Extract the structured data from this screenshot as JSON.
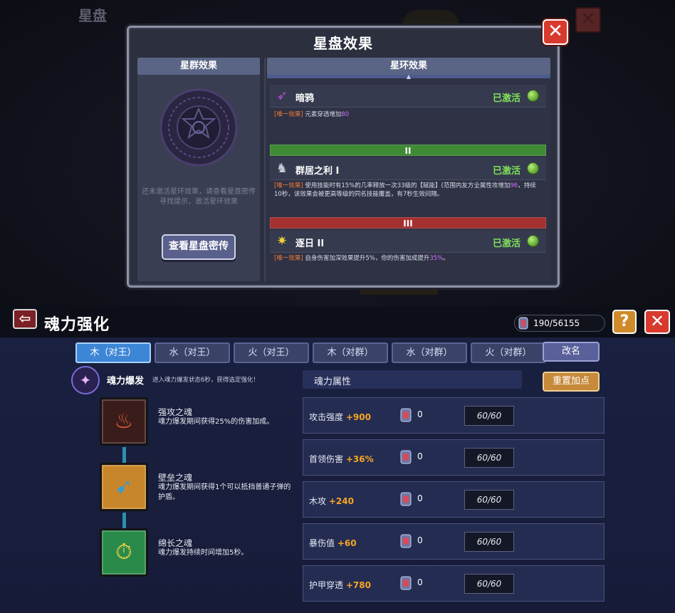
{
  "top": {
    "bg_title": "星盘",
    "dialog": {
      "title": "星盘效果",
      "close_glyph": "✕",
      "left": {
        "header": "星群效果",
        "hint": "还未激活星环效果，请查看星盘密传寻找提示，激活星环效果",
        "button": "查看星盘密传"
      },
      "right": {
        "header": "星环效果",
        "tier_top_glyph": "▲",
        "effects": [
          {
            "icon": "raven-icon",
            "name": "暗鸦",
            "state": "已激活",
            "tag": "[唯一效果]",
            "desc": "元素穿透增加",
            "highlight": "80",
            "desc_tail": ""
          },
          {
            "icon": "wolf-icon",
            "name": "群居之利 I",
            "state": "已激活",
            "tag": "[唯一效果]",
            "desc": "使用技能时有15%的几率释放一次33级的【赋能】(范围内友方全属性攻增加",
            "highlight": "96",
            "desc_tail": "，持续10秒，该效果会被更高等级的同名技能覆盖，有7秒生效间隔。"
          },
          {
            "icon": "sun-icon",
            "name": "逐日 II",
            "state": "已激活",
            "tag": "[唯一效果]",
            "desc": "自身伤害加深效果提升5%，你的伤害加成提升",
            "highlight": "35%",
            "desc_tail": "。"
          }
        ],
        "tiers": [
          "II",
          "III"
        ]
      }
    }
  },
  "bottom": {
    "back_glyph": "⇦",
    "title": "魂力强化",
    "currency": "190/56155",
    "help_glyph": "?",
    "close_glyph": "✕",
    "tabs": [
      "木（对王）",
      "水（对王）",
      "火（对王）",
      "木（对群）",
      "水（对群）",
      "火（对群）"
    ],
    "active_tab": 0,
    "rename": "改名",
    "burst": {
      "name": "魂力爆发",
      "desc": "进入魂力爆发状态6秒，获得选定强化！"
    },
    "souls": [
      {
        "icon": "fox-spirit-icon",
        "name": "强攻之魂",
        "desc": "魂力爆发期间获得25%的伤害加成。"
      },
      {
        "icon": "shield-bow-icon",
        "name": "壁垒之魂",
        "desc": "魂力爆发期间获得1个可以抵挡普通子弹的护盾。"
      },
      {
        "icon": "clock-potion-icon",
        "name": "绵长之魂",
        "desc": "魂力爆发持续时间增加5秒。"
      }
    ],
    "attr_header": "魂力属性",
    "reset": "重置加点",
    "attributes": [
      {
        "name": "攻击强度",
        "bonus": "+900",
        "count": "0",
        "cap": "60/60"
      },
      {
        "name": "首领伤害",
        "bonus": "+36%",
        "count": "0",
        "cap": "60/60"
      },
      {
        "name": "木攻",
        "bonus": "+240",
        "count": "0",
        "cap": "60/60"
      },
      {
        "name": "暴伤值",
        "bonus": "+60",
        "count": "0",
        "cap": "60/60"
      },
      {
        "name": "护甲穿透",
        "bonus": "+780",
        "count": "0",
        "cap": "60/60"
      }
    ]
  }
}
